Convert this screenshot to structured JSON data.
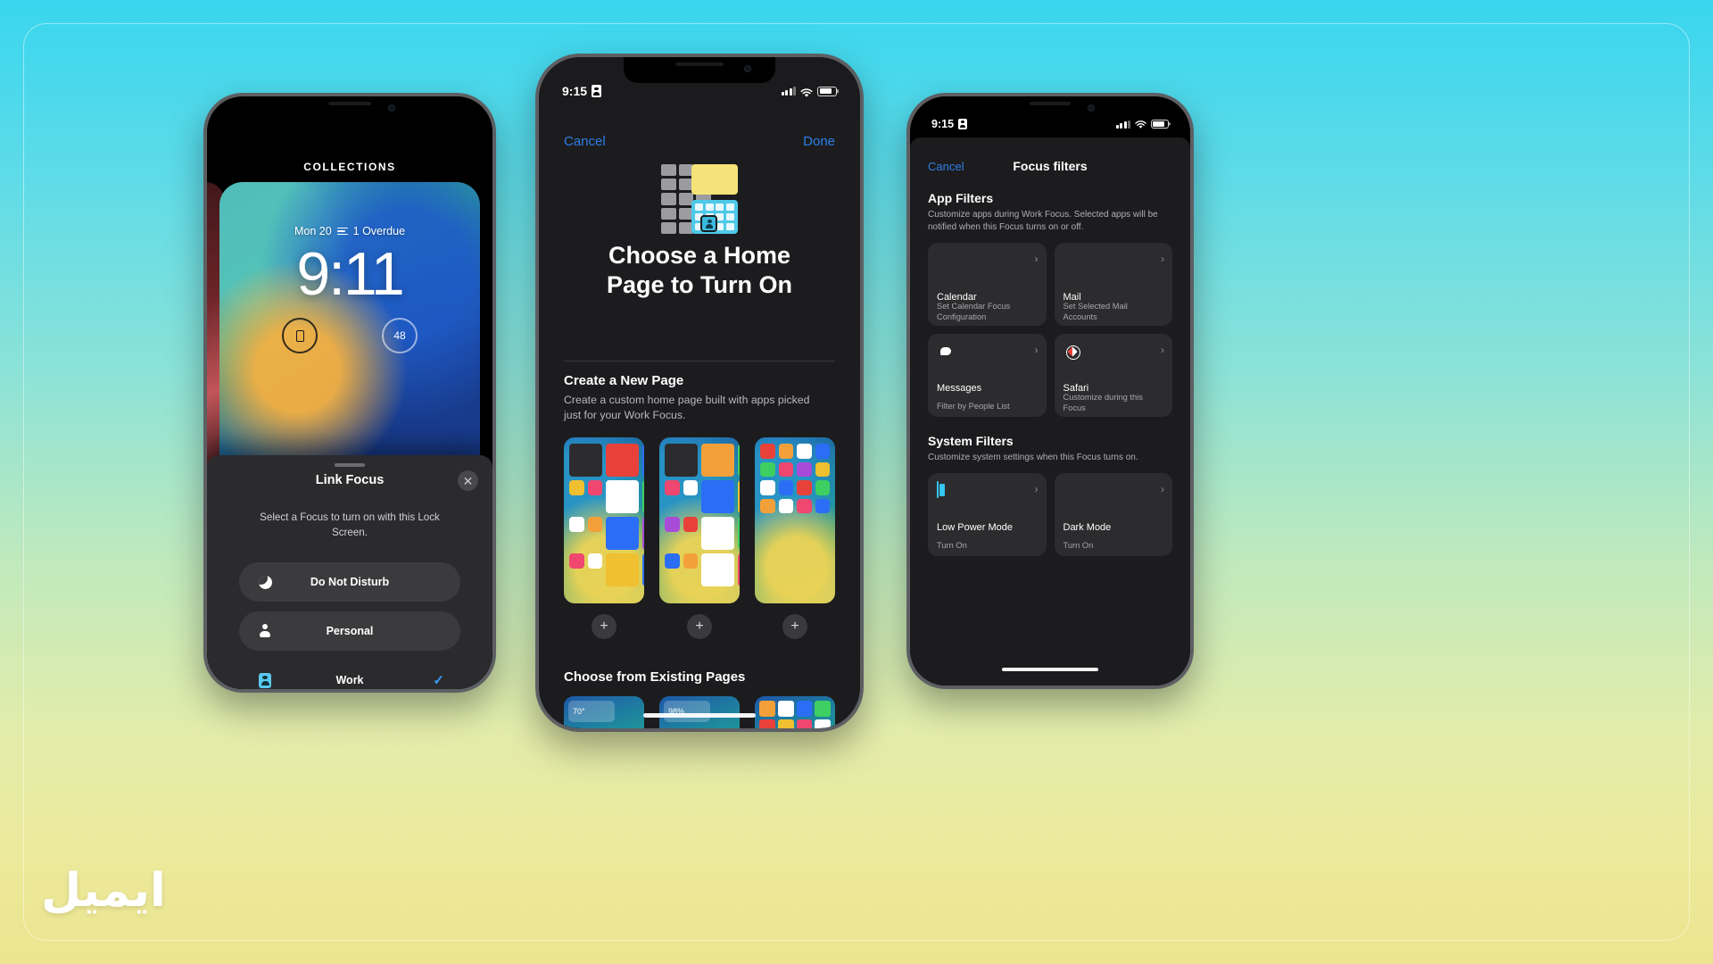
{
  "background": {
    "gradient_top": "#39d6ef",
    "gradient_bottom": "#ece58f"
  },
  "watermark": {
    "text": "ايميل"
  },
  "phone_left": {
    "statusbar": {
      "collections_label": "COLLECTIONS"
    },
    "lock_screen": {
      "date": "Mon 20",
      "overdue": "1 Overdue",
      "time": "9:11",
      "widget_left": "",
      "widget_right": "48"
    },
    "sheet": {
      "title": "Link Focus",
      "close_icon": "close-icon",
      "description": "Select a Focus to turn on with this Lock Screen.",
      "options": [
        {
          "label": "Do Not Disturb",
          "icon": "moon-icon",
          "selected": false
        },
        {
          "label": "Personal",
          "icon": "person-icon",
          "selected": false
        },
        {
          "label": "Work",
          "icon": "badge-icon",
          "selected": true,
          "check": "✓"
        }
      ]
    }
  },
  "phone_center": {
    "statusbar": {
      "time": "9:15",
      "focus_icon": "focus-badge-icon"
    },
    "nav": {
      "cancel": "Cancel",
      "done": "Done"
    },
    "title": "Choose a Home\nPage to Turn On",
    "title_line1": "Choose a Home",
    "title_line2": "Page to Turn On",
    "create_section": {
      "heading": "Create a New Page",
      "description": "Create a custom home page built with apps picked just for your Work Focus.",
      "add_icon": "plus-icon",
      "thumbnails": [
        "page-preview-1",
        "page-preview-2",
        "page-preview-3"
      ]
    },
    "existing_section": {
      "heading": "Choose from Existing Pages",
      "thumbnails": [
        "existing-page-1",
        "existing-page-2",
        "existing-page-3"
      ],
      "widget_labels": [
        "70°",
        "98%"
      ]
    }
  },
  "phone_right": {
    "statusbar": {
      "time": "9:15",
      "focus_icon": "focus-badge-icon"
    },
    "nav": {
      "cancel": "Cancel",
      "title": "Focus filters"
    },
    "app_filters": {
      "heading": "App Filters",
      "description": "Customize apps during Work Focus. Selected apps will be notified when this Focus turns on or off.",
      "cards": [
        {
          "icon": "calendar-app-icon",
          "title": "Calendar",
          "subtitle": "Set Calendar Focus Configuration",
          "chevron": "›"
        },
        {
          "icon": "mail-app-icon",
          "title": "Mail",
          "subtitle": "Set Selected Mail Accounts",
          "chevron": "›"
        },
        {
          "icon": "messages-app-icon",
          "title": "Messages",
          "subtitle": "Filter by People List",
          "chevron": "›"
        },
        {
          "icon": "safari-app-icon",
          "title": "Safari",
          "subtitle": "Customize during this Focus",
          "chevron": "›"
        }
      ]
    },
    "system_filters": {
      "heading": "System Filters",
      "description": "Customize system settings when this Focus turns on.",
      "cards": [
        {
          "icon": "low-power-icon",
          "title": "Low Power Mode",
          "subtitle": "Turn On",
          "chevron": "›"
        },
        {
          "icon": "dark-mode-icon",
          "title": "Dark Mode",
          "subtitle": "Turn On",
          "chevron": "›"
        }
      ]
    }
  },
  "accent_color": "#2f7fe8"
}
